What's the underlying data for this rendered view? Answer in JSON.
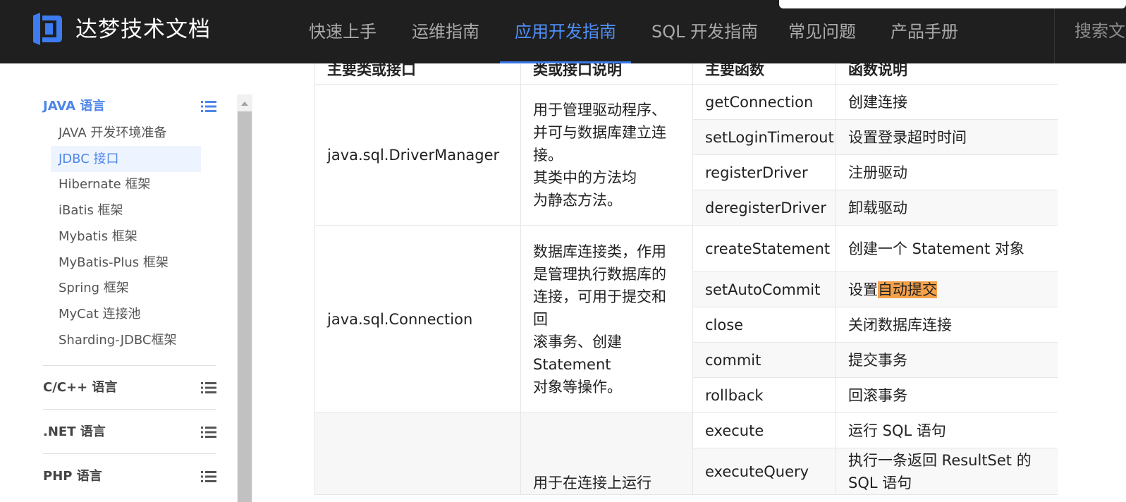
{
  "header": {
    "brand": "达梦技术文档",
    "nav": [
      "快速上手",
      "运维指南",
      "应用开发指南",
      "SQL 开发指南",
      "常见问题",
      "产品手册"
    ],
    "active_nav": "应用开发指南",
    "search_label": "搜索文",
    "accent": "#4f8ff7"
  },
  "sidebar": {
    "sections": [
      {
        "label": "JAVA 语言",
        "items": [
          "JAVA 开发环境准备",
          "JDBC 接口",
          "Hibernate 框架",
          "iBatis 框架",
          "Mybatis 框架",
          "MyBatis-Plus 框架",
          "Spring 框架",
          "MyCat 连接池",
          "Sharding-JDBC框架"
        ],
        "selected": "JDBC 接口"
      },
      {
        "label": "C/C++ 语言"
      },
      {
        "label": ".NET 语言"
      },
      {
        "label": "PHP 语言"
      }
    ]
  },
  "table": {
    "headers": [
      "主要类或接口",
      "类或接口说明",
      "主要函数",
      "函数说明"
    ],
    "groups": [
      {
        "class": "java.sql.DriverManager",
        "desc": "用于管理驱动程序、\n并可与数据库建立连接。\n其类中的方法均\n为静态方法。",
        "rows": [
          {
            "fn": "getConnection",
            "fdesc": "创建连接"
          },
          {
            "fn": "setLoginTimerout",
            "fdesc": "设置登录超时时间"
          },
          {
            "fn": "registerDriver",
            "fdesc": "注册驱动"
          },
          {
            "fn": "deregisterDriver",
            "fdesc": "卸载驱动"
          }
        ]
      },
      {
        "class": "java.sql.Connection",
        "desc": "数据库连接类，作用是管理执行数据库的连接，可用于提交和回\n滚事务、创建 Statement\n对象等操作。",
        "rows": [
          {
            "fn": "createStatement",
            "fdesc": "创建一个 Statement 对象"
          },
          {
            "fn": "setAutoCommit",
            "fdesc_pre": "设置",
            "fdesc_hl": "自动提交"
          },
          {
            "fn": "close",
            "fdesc": "关闭数据库连接"
          },
          {
            "fn": "commit",
            "fdesc": "提交事务"
          },
          {
            "fn": "rollback",
            "fdesc": "回滚事务"
          }
        ]
      },
      {
        "class": "",
        "desc": "用于在连接上运行",
        "rows": [
          {
            "fn": "execute",
            "fdesc": "运行 SQL 语句"
          },
          {
            "fn": "executeQuery",
            "fdesc": "执行一条返回 ResultSet 的 SQL 语句"
          }
        ]
      }
    ]
  }
}
